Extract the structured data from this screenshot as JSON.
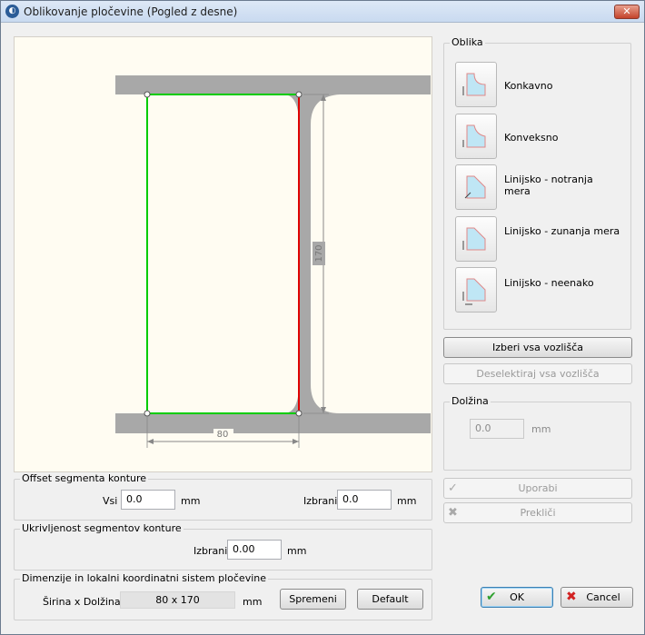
{
  "window": {
    "title": "Oblikovanje pločevine (Pogled z desne)",
    "app_icon": "app-logo-icon",
    "close_glyph": "✕"
  },
  "drawing": {
    "dim_height": "170",
    "dim_width": "80"
  },
  "oblika": {
    "legend": "Oblika",
    "items": [
      {
        "label": "Konkavno",
        "icon": "concave-shape-icon"
      },
      {
        "label": "Konveksno",
        "icon": "convex-shape-icon"
      },
      {
        "label": "Linijsko - notranja mera",
        "icon": "linear-inner-shape-icon"
      },
      {
        "label": "Linijsko - zunanja mera",
        "icon": "linear-outer-shape-icon"
      },
      {
        "label": "Linijsko - neenako",
        "icon": "linear-unequal-shape-icon"
      }
    ]
  },
  "buttons": {
    "select_all": "Izberi vsa vozlišča",
    "deselect_all": "Deselektiraj vsa vozlišča",
    "apply": "Uporabi",
    "cancel_edit": "Prekliči",
    "ok": "OK",
    "cancel": "Cancel",
    "change": "Spremeni",
    "default": "Default"
  },
  "length": {
    "legend": "Dolžina",
    "value": "0.0",
    "unit": "mm"
  },
  "offset": {
    "legend": "Offset segmenta konture",
    "all_label": "Vsi",
    "all_value": "0.0",
    "all_unit": "mm",
    "selected_label": "Izbrani",
    "selected_value": "0.0",
    "selected_unit": "mm"
  },
  "curvature": {
    "legend": "Ukrivljenost segmentov konture",
    "selected_label": "Izbrani",
    "selected_value": "0.00",
    "selected_unit": "mm"
  },
  "dimensions": {
    "legend": "Dimenzije in lokalni koordinatni sistem pločevine",
    "label": "Širina x Dolžina",
    "value": "80 x 170",
    "unit": "mm"
  },
  "colors": {
    "selected_edge": "#e00000",
    "contour": "#00cc00",
    "beam": "#a8a8a8"
  }
}
